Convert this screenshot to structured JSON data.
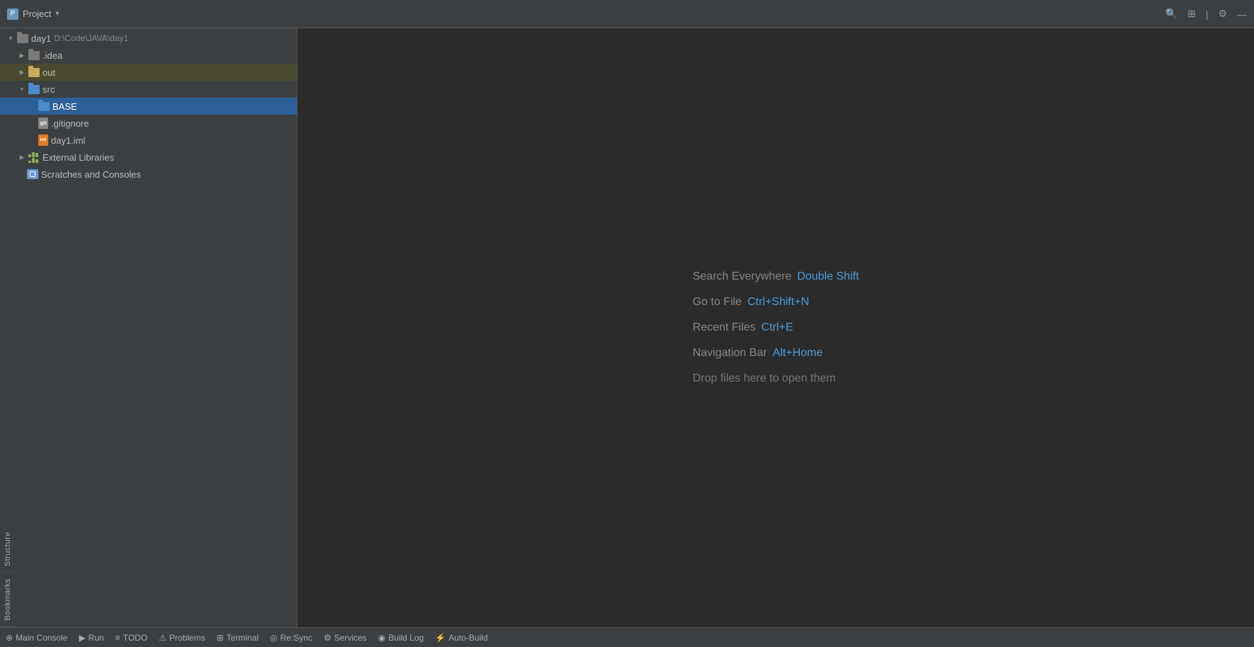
{
  "titlebar": {
    "project_label": "Project",
    "dropdown_char": "▾"
  },
  "sidebar": {
    "tree": [
      {
        "id": "day1",
        "label": "day1",
        "path": "D:\\Code\\JAVA\\day1",
        "indent": 0,
        "type": "root",
        "expanded": true,
        "arrow": "▾"
      },
      {
        "id": "idea",
        "label": ".idea",
        "indent": 1,
        "type": "folder-gray",
        "expanded": false,
        "arrow": "▶"
      },
      {
        "id": "out",
        "label": "out",
        "indent": 1,
        "type": "folder-yellow",
        "expanded": false,
        "arrow": "▶",
        "highlighted": true
      },
      {
        "id": "src",
        "label": "src",
        "indent": 1,
        "type": "folder-blue",
        "expanded": true,
        "arrow": "▾"
      },
      {
        "id": "BASE",
        "label": "BASE",
        "indent": 2,
        "type": "folder-blue",
        "expanded": false,
        "arrow": "",
        "selected": true
      },
      {
        "id": "gitignore",
        "label": ".gitignore",
        "indent": 2,
        "type": "file-gitignore",
        "arrow": ""
      },
      {
        "id": "day1iml",
        "label": "day1.iml",
        "indent": 2,
        "type": "file-iml",
        "arrow": ""
      },
      {
        "id": "extlibs",
        "label": "External Libraries",
        "indent": 1,
        "type": "extlib",
        "expanded": false,
        "arrow": "▶"
      },
      {
        "id": "scratches",
        "label": "Scratches and Consoles",
        "indent": 1,
        "type": "scratches",
        "arrow": ""
      }
    ]
  },
  "main": {
    "hints": [
      {
        "label": "Search Everywhere",
        "shortcut": "Double Shift",
        "type": "shortcut"
      },
      {
        "label": "Go to File",
        "shortcut": "Ctrl+Shift+N",
        "type": "shortcut"
      },
      {
        "label": "Recent Files",
        "shortcut": "Ctrl+E",
        "type": "shortcut"
      },
      {
        "label": "Navigation Bar",
        "shortcut": "Alt+Home",
        "type": "shortcut"
      },
      {
        "label": "Drop files here to open them",
        "type": "plain"
      }
    ]
  },
  "statusbar": {
    "items": [
      {
        "icon": "⊕",
        "label": "Main Console"
      },
      {
        "icon": "▶",
        "label": "Run"
      },
      {
        "icon": "≡",
        "label": "TODO"
      },
      {
        "icon": "⚠",
        "label": "Problems"
      },
      {
        "icon": "⊞",
        "label": "Terminal"
      },
      {
        "icon": "◎",
        "label": "Re:Sync"
      },
      {
        "icon": "⚙",
        "label": "Services"
      },
      {
        "icon": "◉",
        "label": "Build Log"
      },
      {
        "icon": "⚡",
        "label": "Auto-Build"
      }
    ]
  },
  "edge_tabs": [
    {
      "label": "Structure"
    },
    {
      "label": "Bookmarks"
    }
  ],
  "icons": {
    "search": "🔍",
    "layout": "⊞",
    "settings": "⚙",
    "minimize": "—"
  }
}
